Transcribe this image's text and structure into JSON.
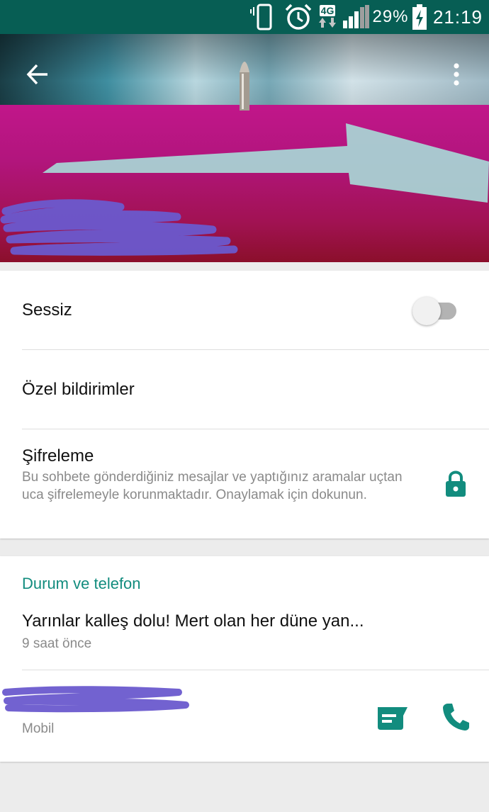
{
  "status_bar": {
    "network_type": "4G",
    "battery_percent": "29%",
    "time": "21:19",
    "icons": [
      "vibrate-icon",
      "alarm-icon",
      "network-4g-icon",
      "signal-icon",
      "battery-charging-icon"
    ]
  },
  "header": {
    "back_icon": "arrow-back-icon",
    "menu_icon": "more-vert-icon",
    "contact_name_redacted": true
  },
  "settings": {
    "mute": {
      "label": "Sessiz",
      "enabled": false
    },
    "custom_notifications": {
      "label": "Özel bildirimler"
    },
    "encryption": {
      "label": "Şifreleme",
      "description": "Bu sohbete gönderdiğiniz mesajlar ve yaptığınız aramalar uçtan uca şifrelemeyle korunmaktadır. Onaylamak için dokunun.",
      "icon": "lock-icon"
    }
  },
  "about": {
    "section_title": "Durum ve telefon",
    "status_text": "Yarınlar kalleş dolu! Mert olan her düne yan...",
    "status_time": "9 saat önce",
    "phone_redacted": true,
    "phone_type": "Mobil",
    "message_icon": "message-icon",
    "call_icon": "call-icon"
  },
  "colors": {
    "status_bar": "#075e54",
    "accent": "#128c7e",
    "background": "#ececec",
    "redaction": "#6a5acd"
  }
}
